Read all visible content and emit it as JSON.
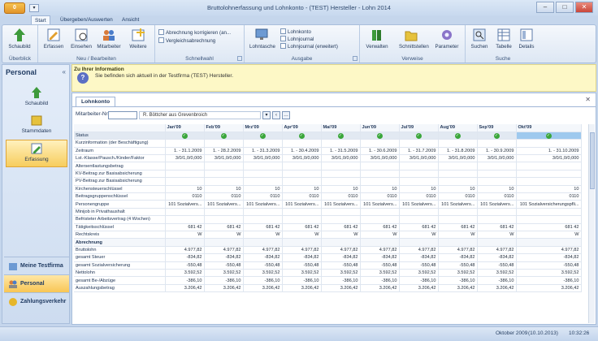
{
  "window": {
    "title": "Bruttolohnerfassung und Lohnkonto - (TEST) Hersteller - Lohn 2014",
    "app_button": "0"
  },
  "tabs": [
    {
      "label": "Start"
    },
    {
      "label": "Übergeben/Auswerten"
    },
    {
      "label": "Ansicht"
    }
  ],
  "ribbon": {
    "groups": [
      {
        "label": "Überblick"
      },
      {
        "label": "Neu / Bearbeiten"
      },
      {
        "label": "Schnellwahl"
      },
      {
        "label": "Ausgabe"
      },
      {
        "label": "Verweise"
      },
      {
        "label": "Suche"
      }
    ],
    "buttons": {
      "schaubild": "Schaubild",
      "erfassen": "Erfassen",
      "einsehen": "Einsehen",
      "mitarbeiter": "Mitarbeiter",
      "weitere": "Weitere",
      "lohntasche": "Lohntasche",
      "verwalten": "Verwalten",
      "schnittstellen": "Schnittstellen",
      "parameter": "Parameter",
      "suchen": "Suchen",
      "tabelle": "Tabelle",
      "details": "Details"
    },
    "schnellwahl": [
      "Abrechnung korrigieren (an...",
      "Vergleichsabrechnung"
    ],
    "ausgabe": [
      "Lohnkonto",
      "Lohnjournal",
      "Lohnjournal (erweitert)"
    ]
  },
  "info": {
    "title": "Zu Ihrer Information",
    "text": "Sie befinden sich aktuell in der Testfirma (TEST) Hersteller."
  },
  "sidebar": {
    "title": "Personal",
    "items": [
      {
        "label": "Schaubild"
      },
      {
        "label": "Stammdaten"
      },
      {
        "label": "Erfassung"
      }
    ],
    "nav": [
      {
        "label": "Meine Testfirma"
      },
      {
        "label": "Personal"
      },
      {
        "label": "Zahlungsverkehr"
      }
    ]
  },
  "content": {
    "tab": "Lohnkonto",
    "employee_label": "Mitarbeiter-Nr.",
    "employee_name": "R. Böttcher aus Grevenbroich",
    "months": [
      "Jan'09",
      "Feb'09",
      "Mrz'09",
      "Apr'09",
      "Mai'09",
      "Jun'09",
      "Jul'09",
      "Aug'09",
      "Sep'09",
      "Okt'09"
    ],
    "rows": [
      {
        "label": "Status",
        "type": "status"
      },
      {
        "label": "Kurzinformation (der Beschäftigung)",
        "values": [
          "",
          "",
          "",
          "",
          "",
          "",
          "",
          "",
          "",
          ""
        ]
      },
      {
        "label": "Zeitraum",
        "values": [
          "1. - 31.1.2009",
          "1. - 28.2.2009",
          "1. - 31.3.2009",
          "1. - 30.4.2009",
          "1. - 31.5.2009",
          "1. - 30.6.2009",
          "1. - 31.7.2009",
          "1. - 31.8.2009",
          "1. - 30.9.2009",
          "1. - 31.10.2009"
        ]
      },
      {
        "label": "Lst.-Klasse/Pausch./Kinder/Faktor",
        "values": [
          "3/0/1,0/0,000",
          "3/0/1,0/0,000",
          "3/0/1,0/0,000",
          "3/0/1,0/0,000",
          "3/0/1,0/0,000",
          "3/0/1,0/0,000",
          "3/0/1,0/0,000",
          "3/0/1,0/0,000",
          "3/0/1,0/0,000",
          "3/0/1,0/0,000"
        ]
      },
      {
        "label": "Altersentlastungsbetrag",
        "values": [
          "",
          "",
          "",
          "",
          "",
          "",
          "",
          "",
          "",
          ""
        ]
      },
      {
        "label": "KV-Beitrag zur Basisabsicherung",
        "values": [
          "",
          "",
          "",
          "",
          "",
          "",
          "",
          "",
          "",
          ""
        ]
      },
      {
        "label": "PV-Beitrag zur Basisabsicherung",
        "values": [
          "",
          "",
          "",
          "",
          "",
          "",
          "",
          "",
          "",
          ""
        ]
      },
      {
        "label": "Kirchensteuerschlüssel",
        "values": [
          "10",
          "10",
          "10",
          "10",
          "10",
          "10",
          "10",
          "10",
          "10",
          "10"
        ]
      },
      {
        "label": "Beitragsgruppenschlüssel",
        "values": [
          "0110",
          "0110",
          "0110",
          "0110",
          "0110",
          "0110",
          "0110",
          "0110",
          "0110",
          "0110"
        ]
      },
      {
        "label": "Personengruppe",
        "values": [
          "101 Sozialvers...",
          "101 Sozialvers...",
          "101 Sozialvers...",
          "101 Sozialvers...",
          "101 Sozialvers...",
          "101 Sozialvers...",
          "101 Sozialvers...",
          "101 Sozialvers...",
          "101 Sozialvers...",
          "101 Sozialversicherungspfli..."
        ]
      },
      {
        "label": "Minijob in Privathaushalt",
        "values": [
          "",
          "",
          "",
          "",
          "",
          "",
          "",
          "",
          "",
          ""
        ]
      },
      {
        "label": "Befristeter Arbeitsvertrag (4 Wochen)",
        "values": [
          "",
          "",
          "",
          "",
          "",
          "",
          "",
          "",
          "",
          ""
        ]
      },
      {
        "label": "Tätigkeitsschlüssel",
        "values": [
          "681 42",
          "681 42",
          "681 42",
          "681 42",
          "681 42",
          "681 42",
          "681 42",
          "681 42",
          "681 42",
          "681 42"
        ]
      },
      {
        "label": "Rechtskreis",
        "values": [
          "W",
          "W",
          "W",
          "W",
          "W",
          "W",
          "W",
          "W",
          "W",
          "W"
        ]
      },
      {
        "label": "Abrechnung",
        "type": "section"
      },
      {
        "label": "Bruttolohn",
        "values": [
          "4.977,82",
          "4.977,82",
          "4.977,82",
          "4.977,82",
          "4.977,82",
          "4.977,82",
          "4.977,82",
          "4.977,82",
          "4.977,82",
          "4.977,82"
        ]
      },
      {
        "label": "gesamt Steuer",
        "values": [
          "-834,82",
          "-834,82",
          "-834,82",
          "-834,82",
          "-834,82",
          "-834,82",
          "-834,82",
          "-834,82",
          "-834,82",
          "-834,82"
        ]
      },
      {
        "label": "gesamt Sozialversicherung",
        "values": [
          "-550,48",
          "-550,48",
          "-550,48",
          "-550,48",
          "-550,48",
          "-550,48",
          "-550,48",
          "-550,48",
          "-550,48",
          "-550,48"
        ]
      },
      {
        "label": "Nettolohn",
        "values": [
          "3.592,52",
          "3.592,52",
          "3.592,52",
          "3.592,52",
          "3.592,52",
          "3.592,52",
          "3.592,52",
          "3.592,52",
          "3.592,52",
          "3.592,52"
        ]
      },
      {
        "label": "gesamt Be-/Abzüge",
        "values": [
          "-386,10",
          "-386,10",
          "-386,10",
          "-386,10",
          "-386,10",
          "-386,10",
          "-386,10",
          "-386,10",
          "-386,10",
          "-386,10"
        ]
      },
      {
        "label": "Auszahlungsbetrag",
        "values": [
          "3.206,42",
          "3.206,42",
          "3.206,42",
          "3.206,42",
          "3.206,42",
          "3.206,42",
          "3.206,42",
          "3.206,42",
          "3.206,42",
          "3.206,42"
        ]
      }
    ]
  },
  "statusbar": {
    "period": "Oktober 2009",
    "date": "(10.10.2013)",
    "time": "10:32:26"
  }
}
